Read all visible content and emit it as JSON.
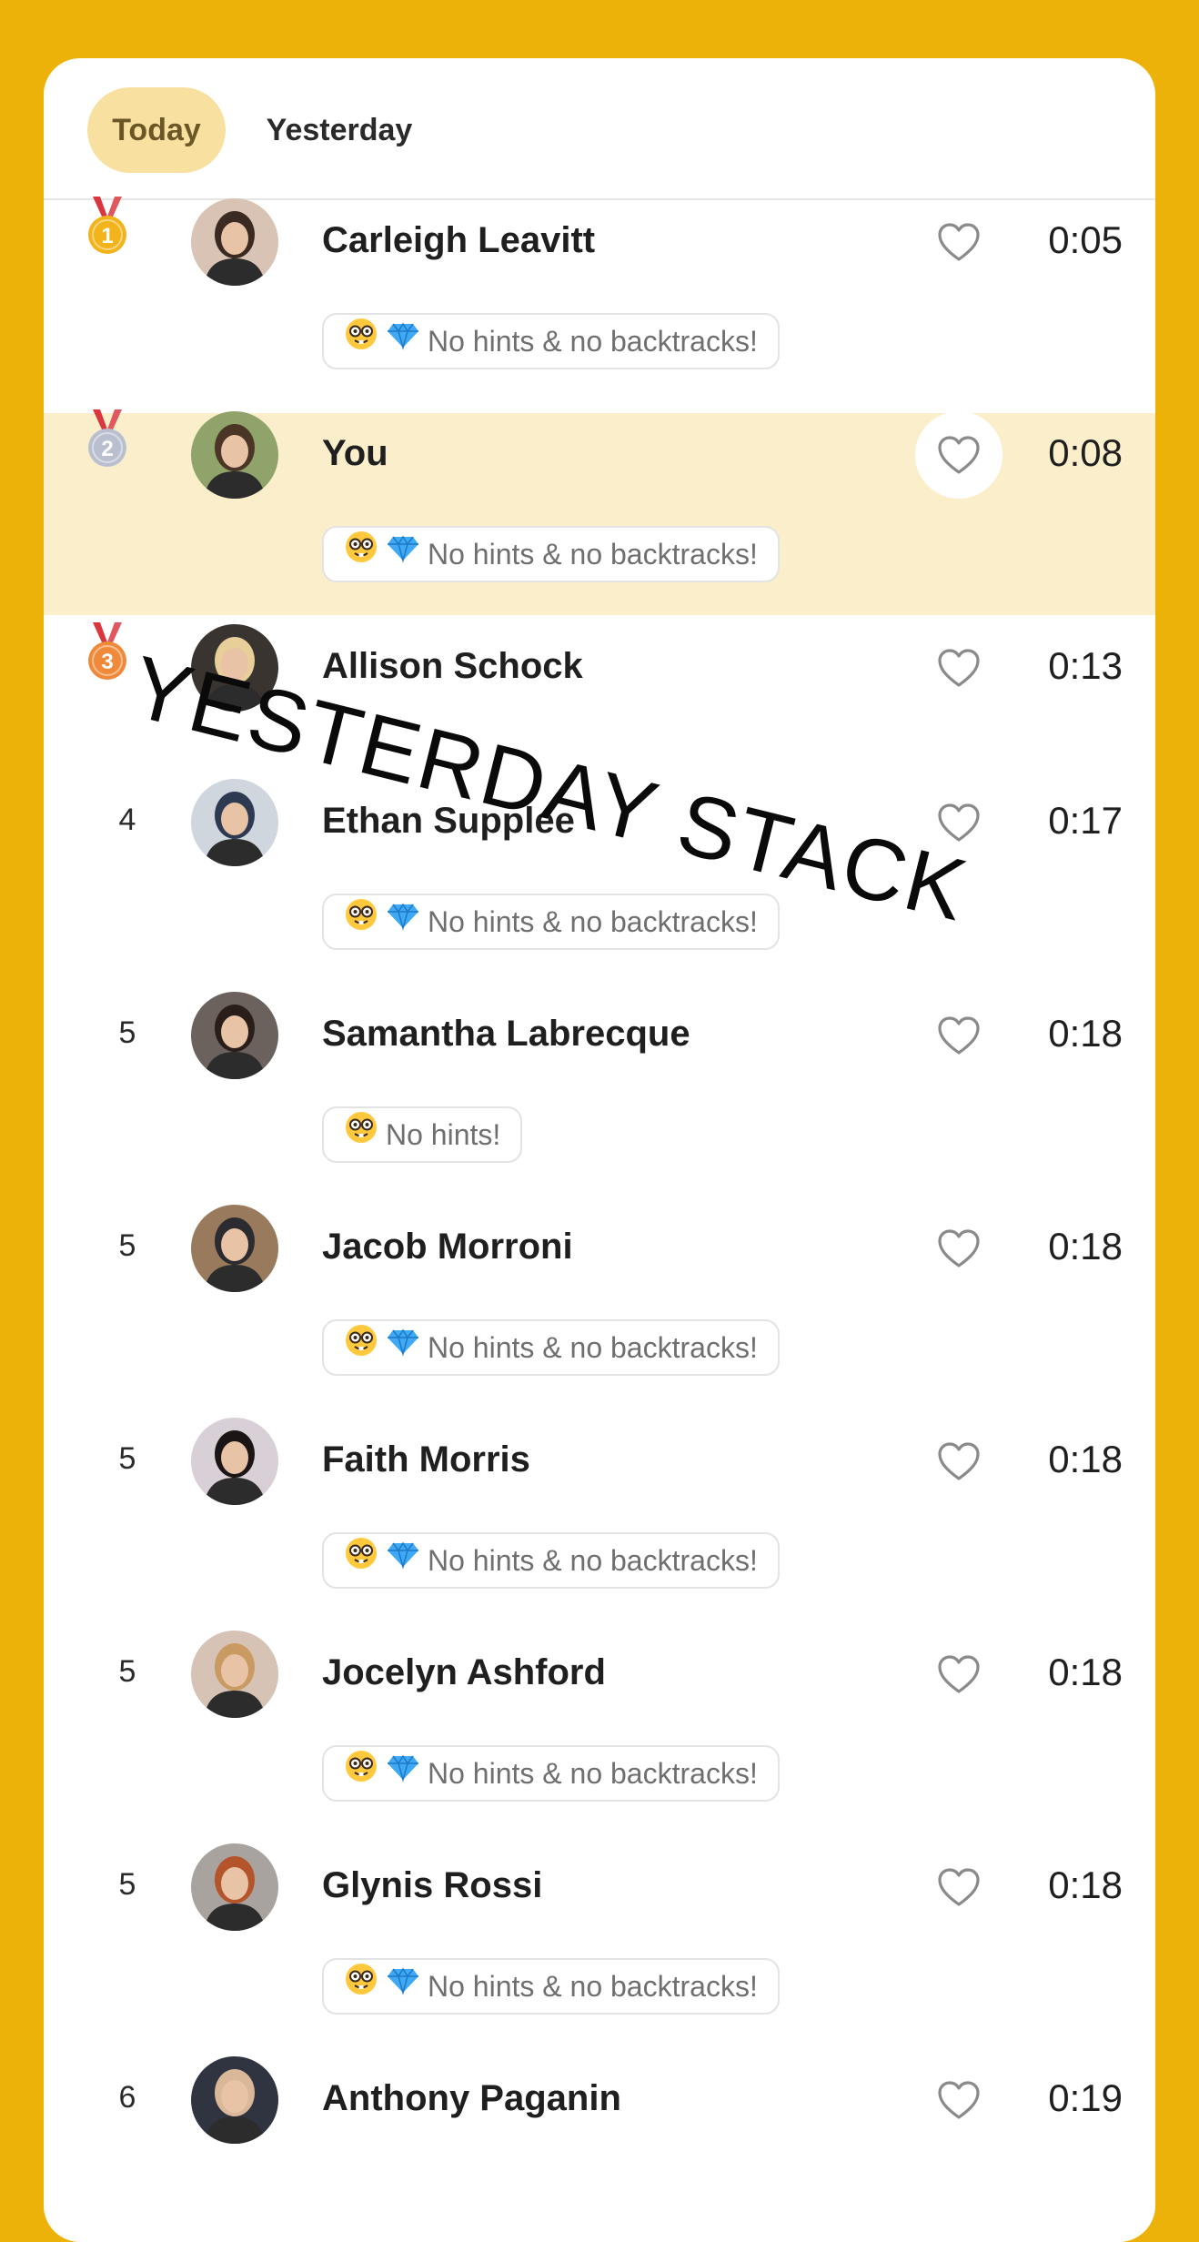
{
  "tabs": {
    "today": "Today",
    "yesterday": "Yesterday"
  },
  "watermark": "YESTERDAY STACK",
  "badges": {
    "both": "No hints & no backtracks!",
    "hints_only": "No hints!"
  },
  "colors": {
    "background": "#EDB209",
    "highlight": "#FBEECB",
    "tab_active": "#F8E1A0",
    "gold": "#F2B41A",
    "silver": "#B9BFCF",
    "bronze": "#F08A3A"
  },
  "icons": {
    "heart": "heart-outline-icon",
    "medal": "medal-icon",
    "nerd": "nerd-face-emoji",
    "gem": "gem-stone-emoji"
  },
  "leaderboard": [
    {
      "rank": "1",
      "medal": "gold",
      "name": "Carleigh Leavitt",
      "time": "0:05",
      "badge": "both"
    },
    {
      "rank": "2",
      "medal": "silver",
      "name": "You",
      "time": "0:08",
      "badge": "both",
      "is_you": true
    },
    {
      "rank": "3",
      "medal": "bronze",
      "name": "Allison Schock",
      "time": "0:13",
      "badge": null
    },
    {
      "rank": "4",
      "name": "Ethan Supplee",
      "time": "0:17",
      "badge": "both"
    },
    {
      "rank": "5",
      "name": "Samantha Labrecque",
      "time": "0:18",
      "badge": "hints_only"
    },
    {
      "rank": "5",
      "name": "Jacob Morroni",
      "time": "0:18",
      "badge": "both"
    },
    {
      "rank": "5",
      "name": "Faith Morris",
      "time": "0:18",
      "badge": "both"
    },
    {
      "rank": "5",
      "name": "Jocelyn Ashford",
      "time": "0:18",
      "badge": "both"
    },
    {
      "rank": "5",
      "name": "Glynis Rossi",
      "time": "0:18",
      "badge": "both"
    },
    {
      "rank": "6",
      "name": "Anthony Paganin",
      "time": "0:19",
      "badge": null
    }
  ]
}
